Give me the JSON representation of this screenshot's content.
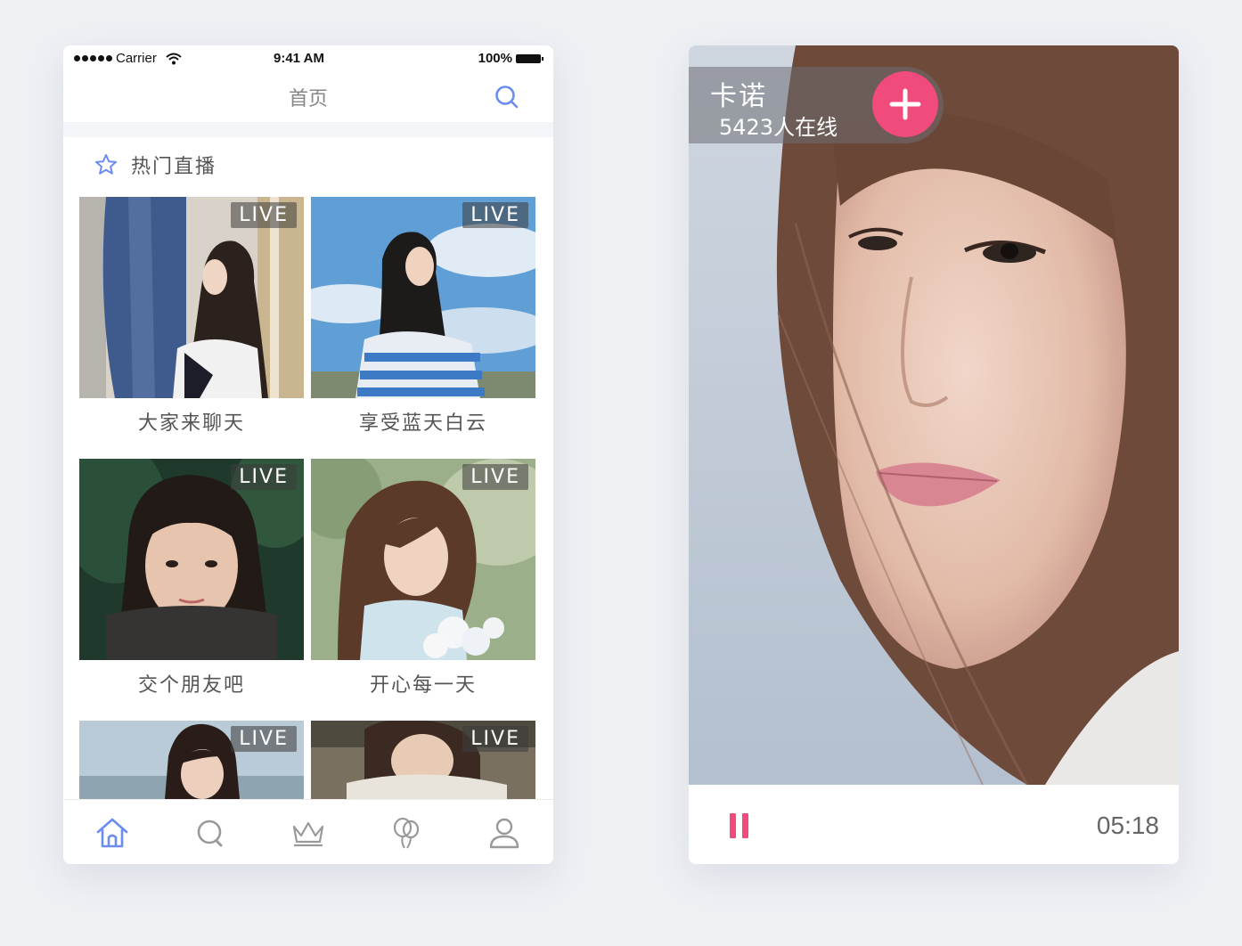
{
  "status_bar": {
    "carrier": "Carrier",
    "time": "9:41 AM",
    "battery": "100%"
  },
  "nav": {
    "title": "首页"
  },
  "section": {
    "title": "热门直播"
  },
  "live_badge": "LIVE",
  "streams": [
    {
      "title": "大家来聊天"
    },
    {
      "title": "享受蓝天白云"
    },
    {
      "title": "交个朋友吧"
    },
    {
      "title": "开心每一天"
    },
    {
      "title": ""
    },
    {
      "title": ""
    }
  ],
  "tabbar": {
    "tabs": [
      {
        "icon": "home-icon",
        "active": true
      },
      {
        "icon": "search-icon",
        "active": false
      },
      {
        "icon": "crown-icon",
        "active": false
      },
      {
        "icon": "balloon-icon",
        "active": false
      },
      {
        "icon": "user-icon",
        "active": false
      }
    ]
  },
  "player": {
    "host_name": "卡诺",
    "viewers": "5423人在线",
    "duration": "05:18"
  },
  "colors": {
    "accent": "#f04b7c",
    "primary_blue": "#6b8cf0",
    "background": "#eef0f4"
  }
}
